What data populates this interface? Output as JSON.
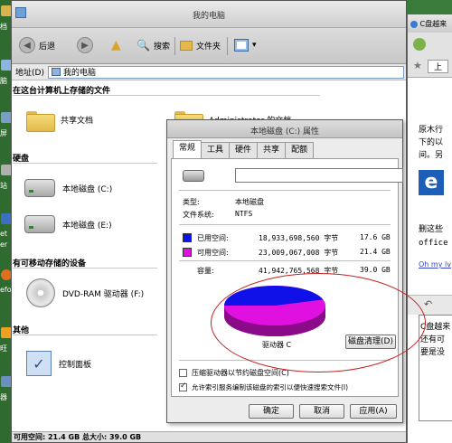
{
  "desktop": {
    "icon_labels": [
      "档",
      "脑",
      "屏",
      "站",
      "et",
      "er",
      "efo",
      "旺",
      "器"
    ]
  },
  "explorer": {
    "title": "我的电脑",
    "toolbar": {
      "back": "后退",
      "search": "搜索",
      "folders": "文件夹"
    },
    "address": {
      "label": "地址(D)",
      "value": "我的电脑"
    },
    "sections": {
      "stored": "在这台计算机上存储的文件",
      "hard_disks": "硬盘",
      "removable": "有可移动存储的设备",
      "other": "其他"
    },
    "items": {
      "shared_docs": "共享文档",
      "admin_docs": "Administrator 的文档",
      "drive_c": "本地磁盘 (C:)",
      "drive_e": "本地磁盘 (E:)",
      "dvd": "DVD-RAM 驱动器 (F:)",
      "control_panel": "控制面板"
    },
    "status": "可用空间: 21.4 GB  总大小: 39.0 GB"
  },
  "dialog": {
    "title": "本地磁盘 (C:) 属性",
    "tabs": [
      "常规",
      "工具",
      "硬件",
      "共享",
      "配额"
    ],
    "name_value": "",
    "type_label": "类型:",
    "type_value": "本地磁盘",
    "fs_label": "文件系统:",
    "fs_value": "NTFS",
    "used_label": "已用空间:",
    "used_bytes": "18,933,698,560 字节",
    "used_gb": "17.6 GB",
    "free_label": "可用空间:",
    "free_bytes": "23,009,067,008 字节",
    "free_gb": "21.4 GB",
    "cap_label": "容量:",
    "cap_bytes": "41,942,765,568 字节",
    "cap_gb": "39.0 GB",
    "drive_label": "驱动器 C",
    "cleanup_button": "磁盘清理(D)",
    "compress_label": "压缩驱动器以节约磁盘空间(C)",
    "index_label": "允许索引服务编制该磁盘的索引以便快速搜索文件(I)",
    "ok": "确定",
    "cancel": "取消",
    "apply": "应用(A)",
    "colors": {
      "used": "#1010e8",
      "free": "#e010e0"
    },
    "usage": {
      "used_gb": 17.6,
      "free_gb": 21.4
    }
  },
  "right_window": {
    "title": "C盘越来",
    "tab": "上",
    "lines": [
      "原木行",
      "下的以",
      "间。另",
      "删这些",
      "office",
      "Oh my lv",
      "C盘越来",
      "还有可",
      "要是没"
    ]
  }
}
